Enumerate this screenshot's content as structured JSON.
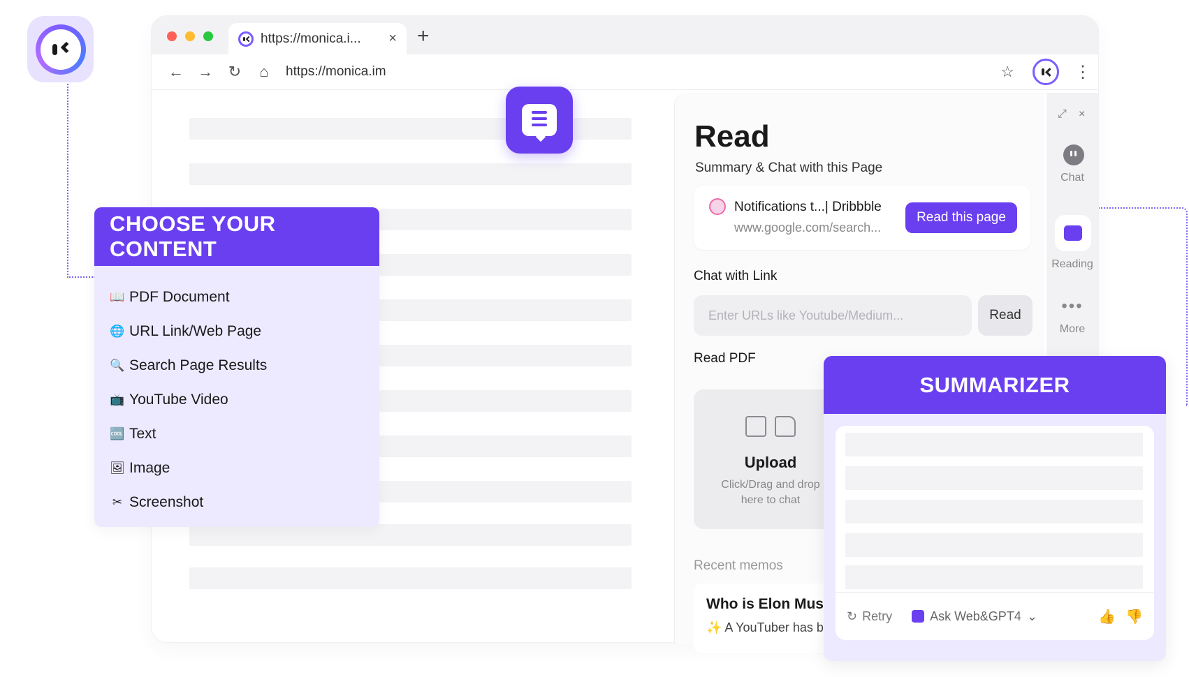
{
  "browser": {
    "tab_title": "https://monica.i...",
    "tab_close": "×",
    "new_tab": "+",
    "url": "https://monica.im",
    "nav": {
      "back": "←",
      "forward": "→",
      "reload": "↻",
      "home": "⌂"
    },
    "star": "☆",
    "menu": "⋮"
  },
  "choose_panel": {
    "title": "CHOOSE YOUR CONTENT",
    "items": [
      {
        "emoji": "📖",
        "label": "PDF Document"
      },
      {
        "emoji": "🌐",
        "label": "URL Link/Web Page"
      },
      {
        "emoji": "🔍",
        "label": "Search Page Results"
      },
      {
        "emoji": "📺",
        "label": "YouTube Video"
      },
      {
        "emoji": "🆒",
        "label": "Text"
      },
      {
        "emoji": "🖼",
        "label": "Image"
      },
      {
        "emoji": "✂",
        "label": "Screenshot"
      }
    ]
  },
  "read_panel": {
    "title": "Read",
    "subtitle": "Summary & Chat with this Page",
    "page_card": {
      "name": "Notifications t...| Dribbble",
      "url": "www.google.com/search...",
      "button": "Read this page"
    },
    "chat_with_link": {
      "label": "Chat with Link",
      "placeholder": "Enter URLs like Youtube/Medium...",
      "button": "Read"
    },
    "read_pdf": {
      "label": "Read PDF",
      "upload_title": "Upload",
      "upload_desc": "Click/Drag and drop here to chat"
    },
    "recent_memos": {
      "label": "Recent memos",
      "memo_title": "Who is Elon Mus",
      "memo_snippet": "A YouTuber has b"
    }
  },
  "rail": {
    "top_icons": [
      "⤢",
      "×"
    ],
    "items": [
      {
        "label": "Chat"
      },
      {
        "label": "Reading"
      },
      {
        "label": "More",
        "icon": "•••"
      }
    ]
  },
  "summarizer": {
    "title": "SUMMARIZER",
    "retry": "Retry",
    "retry_icon": "↻",
    "ask": "Ask Web&GPT4",
    "ask_chevron": "⌄",
    "thumb_up": "👍",
    "thumb_down": "👎"
  },
  "colors": {
    "accent": "#6a3ff0",
    "panel_bg": "#ede9ff"
  }
}
